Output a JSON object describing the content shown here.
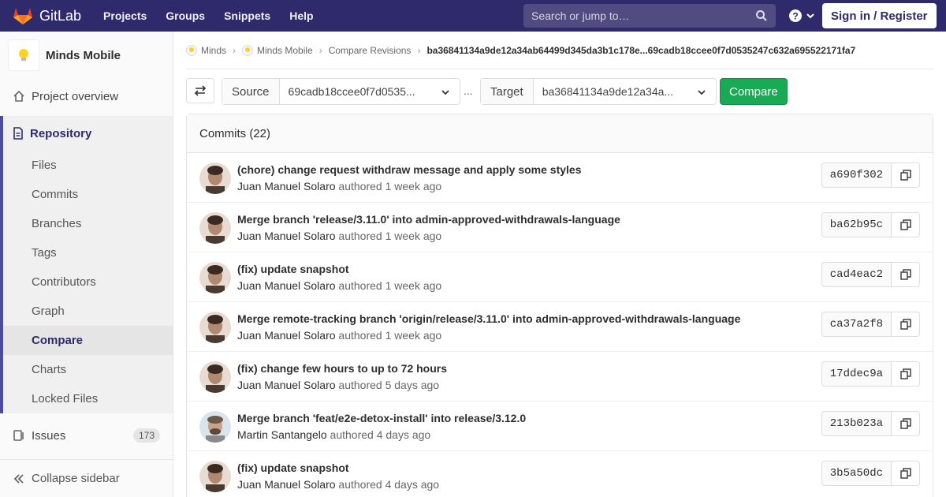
{
  "nav": {
    "brand": "GitLab",
    "links": [
      "Projects",
      "Groups",
      "Snippets",
      "Help"
    ],
    "search_placeholder": "Search or jump to…",
    "signin": "Sign in / Register"
  },
  "sidebar": {
    "project_name": "Minds Mobile",
    "overview": "Project overview",
    "repository": "Repository",
    "repo_items": [
      "Files",
      "Commits",
      "Branches",
      "Tags",
      "Contributors",
      "Graph",
      "Compare",
      "Charts",
      "Locked Files"
    ],
    "active_item": "Compare",
    "issues": "Issues",
    "issues_count": "173",
    "collapse": "Collapse sidebar"
  },
  "breadcrumb": {
    "items": [
      "Minds",
      "Minds Mobile",
      "Compare Revisions"
    ],
    "current": "ba36841134a9de12a34ab64499d345da3b1c178e...69cadb18ccee0f7d0535247c632a695522171fa7"
  },
  "compare": {
    "source_label": "Source",
    "source_value": "69cadb18ccee0f7d0535...",
    "dots": "...",
    "target_label": "Target",
    "target_value": "ba36841134a9de12a34a...",
    "button": "Compare"
  },
  "commits": {
    "header": "Commits (22)",
    "rows": [
      {
        "title": "(chore) change request withdraw message and apply some styles",
        "author": "Juan Manuel Solaro",
        "action": "authored",
        "time": "1 week ago",
        "sha": "a690f302"
      },
      {
        "title": "Merge branch 'release/3.11.0' into admin-approved-withdrawals-language",
        "author": "Juan Manuel Solaro",
        "action": "authored",
        "time": "1 week ago",
        "sha": "ba62b95c"
      },
      {
        "title": "(fix) update snapshot",
        "author": "Juan Manuel Solaro",
        "action": "authored",
        "time": "1 week ago",
        "sha": "cad4eac2"
      },
      {
        "title": "Merge remote-tracking branch 'origin/release/3.11.0' into admin-approved-withdrawals-language",
        "author": "Juan Manuel Solaro",
        "action": "authored",
        "time": "1 week ago",
        "sha": "ca37a2f8"
      },
      {
        "title": "(fix) change few hours to up to 72 hours",
        "author": "Juan Manuel Solaro",
        "action": "authored",
        "time": "5 days ago",
        "sha": "17ddec9a"
      },
      {
        "title": "Merge branch 'feat/e2e-detox-install' into release/3.12.0",
        "author": "Martin Santangelo",
        "action": "authored",
        "time": "4 days ago",
        "sha": "213b023a"
      },
      {
        "title": "(fix) update snapshot",
        "author": "Juan Manuel Solaro",
        "action": "authored",
        "time": "4 days ago",
        "sha": "3b5a50dc"
      }
    ]
  },
  "colors": {
    "nav_bg": "#2f2a6b",
    "accent": "#4b4ba3",
    "compare_btn": "#1aaa55"
  }
}
